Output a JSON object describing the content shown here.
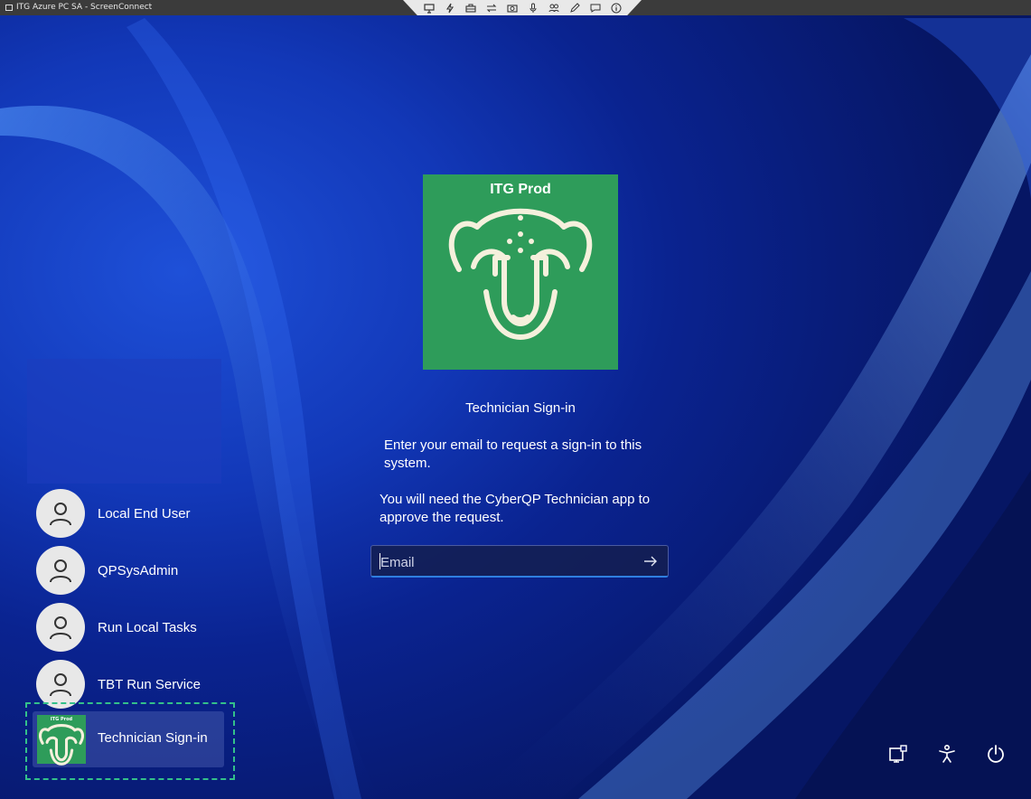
{
  "window": {
    "title": "ITG Azure PC SA - ScreenConnect"
  },
  "toolbar": {
    "icons": [
      "monitor-icon",
      "lightning-icon",
      "toolbox-icon",
      "swap-icon",
      "camera-icon",
      "microphone-icon",
      "users-icon",
      "pencil-icon",
      "chat-icon",
      "info-icon"
    ]
  },
  "logo": {
    "text": "ITG Prod",
    "color": "#2e9c5a"
  },
  "signin": {
    "title": "Technician Sign-in",
    "instruction1": "Enter your email to request a sign-in to this system.",
    "instruction2": "You will need the CyberQP Technician app to approve the request.",
    "email_placeholder": "Email"
  },
  "users": [
    {
      "name": "Local End User"
    },
    {
      "name": "QPSysAdmin"
    },
    {
      "name": "Run Local Tasks"
    },
    {
      "name": "TBT Run Service"
    }
  ],
  "selected_user": {
    "name": "Technician Sign-in",
    "mini_logo_text": "ITG Prod"
  },
  "bottom_icons": [
    "network-icon",
    "accessibility-icon",
    "power-icon"
  ]
}
